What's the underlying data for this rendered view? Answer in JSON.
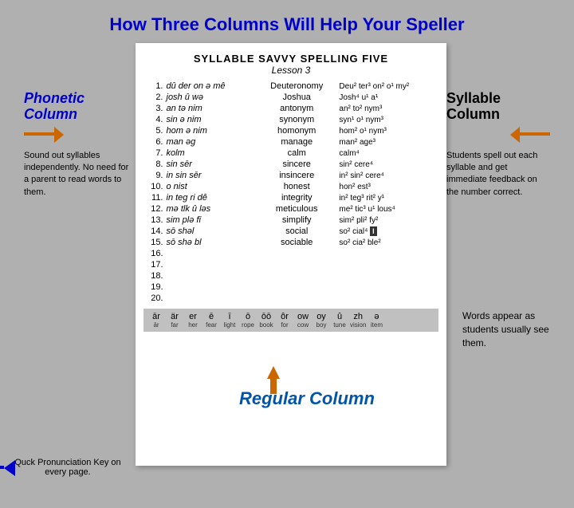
{
  "title": "How Three Columns Will Help Your Speller",
  "document": {
    "title": "SYLLABLE SAVVY SPELLING FIVE",
    "subtitle": "Lesson 3",
    "rows": [
      {
        "num": "1.",
        "phonetic": "dû der on ə mê",
        "regular": "Deuteronomy",
        "syllable": "Deu² ter³ on² o¹ my²"
      },
      {
        "num": "2.",
        "phonetic": "josh û wə",
        "regular": "Joshua",
        "syllable": "Josh⁴ u¹ a¹"
      },
      {
        "num": "3.",
        "phonetic": "an tə nim",
        "regular": "antonym",
        "syllable": "an² to² nym³"
      },
      {
        "num": "4.",
        "phonetic": "sin ə nim",
        "regular": "synonym",
        "syllable": "syn¹ o¹ nym³"
      },
      {
        "num": "5.",
        "phonetic": "hom ə nim",
        "regular": "homonym",
        "syllable": "hom² o¹ nym³"
      },
      {
        "num": "6.",
        "phonetic": "man əg",
        "regular": "manage",
        "syllable": "man² age³"
      },
      {
        "num": "7.",
        "phonetic": "kolm",
        "regular": "calm",
        "syllable": "calm⁴"
      },
      {
        "num": "8.",
        "phonetic": "sin sēr",
        "regular": "sincere",
        "syllable": "sin² cere⁴"
      },
      {
        "num": "9.",
        "phonetic": "in sin sēr",
        "regular": "insincere",
        "syllable": "in² sin² cere⁴"
      },
      {
        "num": "10.",
        "phonetic": "o nist",
        "regular": "honest",
        "syllable": "hon² est³"
      },
      {
        "num": "11.",
        "phonetic": "in teg ri dê",
        "regular": "integrity",
        "syllable": "in² teg³ rit² y¹"
      },
      {
        "num": "12.",
        "phonetic": "mə tlk û ləs",
        "regular": "meticulous",
        "syllable": "me² tic³ u¹ lous⁴"
      },
      {
        "num": "13.",
        "phonetic": "sim plə fī",
        "regular": "simplify",
        "syllable": "sim² pli² fy²"
      },
      {
        "num": "14.",
        "phonetic": "sō shəl",
        "regular": "social",
        "syllable": "so² cial⁴ [I]"
      },
      {
        "num": "15.",
        "phonetic": "sō shə bl",
        "regular": "sociable",
        "syllable": "so² cia² ble²"
      },
      {
        "num": "16.",
        "phonetic": "",
        "regular": "",
        "syllable": ""
      },
      {
        "num": "17.",
        "phonetic": "",
        "regular": "",
        "syllable": ""
      },
      {
        "num": "18.",
        "phonetic": "",
        "regular": "",
        "syllable": ""
      },
      {
        "num": "19.",
        "phonetic": "",
        "regular": "",
        "syllable": ""
      },
      {
        "num": "20.",
        "phonetic": "",
        "regular": "",
        "syllable": ""
      }
    ]
  },
  "annotations": {
    "phonetic_column_label": "Phonetic Column",
    "phonetic_arrow_direction": "right",
    "sound_out_text": "Sound out syllables independently.  No need for a parent to read words to them.",
    "syllable_column_label": "Syllable Column",
    "syllable_arrow_direction": "left",
    "students_spell_text": "Students spell out each syllable and get immediate feedback on the number correct.",
    "words_appear_text": "Words appear as students usually see them.",
    "regular_column_label": "Regular Column",
    "pronunciation_key_label": "Quck Pronunciation Key on every page.",
    "pronunciation_items": [
      {
        "main": "ār",
        "sub": "ār"
      },
      {
        "main": "är",
        "sub": "far"
      },
      {
        "main": "er",
        "sub": "her"
      },
      {
        "main": "ē",
        "sub": "fear"
      },
      {
        "main": "ī",
        "sub": "light"
      },
      {
        "main": "ō",
        "sub": "rope"
      },
      {
        "main": "ōō",
        "sub": "book"
      },
      {
        "main": "ôr",
        "sub": "for"
      },
      {
        "main": "ow",
        "sub": "cow"
      },
      {
        "main": "oy",
        "sub": "boy"
      },
      {
        "main": "û",
        "sub": "tune"
      },
      {
        "main": "zh",
        "sub": "vision"
      },
      {
        "main": "ə",
        "sub": "item"
      }
    ]
  }
}
